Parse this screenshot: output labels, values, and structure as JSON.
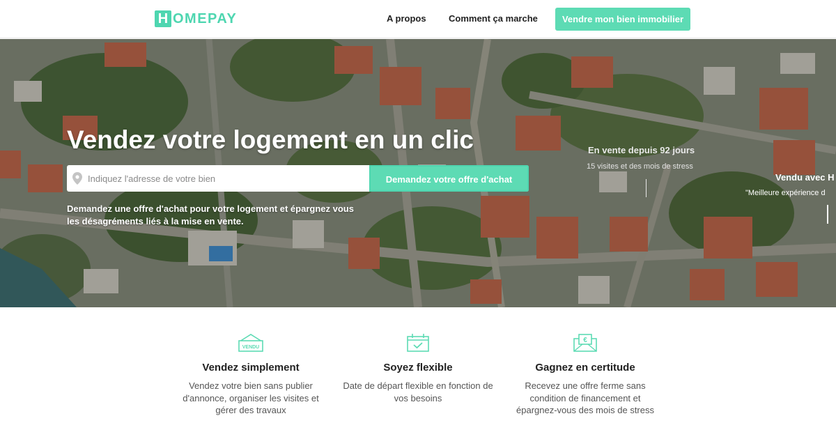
{
  "brand": {
    "logo_letter": "H",
    "logo_rest": "OMEPAY",
    "accent_color": "#5ddbb4"
  },
  "nav": {
    "items": [
      "A propos",
      "Comment ça marche"
    ],
    "cta_label": "Vendre mon bien immobilier"
  },
  "hero": {
    "title": "Vendez votre logement en un clic",
    "search": {
      "placeholder": "Indiquez l'adresse de votre bien",
      "value": "",
      "button_label": "Demandez votre offre d'achat"
    },
    "subtitle": "Demandez une offre d'achat pour votre logement et épargnez vous les désagréments liés à la mise en vente.",
    "story_1": {
      "title": "En vente depuis 92 jours",
      "subtitle": "15 visites et des mois de stress"
    },
    "story_2": {
      "title": "Vendu avec H",
      "subtitle": "\"Meilleure expérience d"
    }
  },
  "features": [
    {
      "icon": "sold-sign-icon",
      "icon_text": "VENDU",
      "title": "Vendez simplement",
      "text": "Vendez votre bien sans publier d'annonce, organiser les visites et gérer des travaux"
    },
    {
      "icon": "calendar-check-icon",
      "title": "Soyez flexible",
      "text": "Date de départ flexible en fonction de vos besoins"
    },
    {
      "icon": "euro-envelope-icon",
      "icon_text": "€",
      "title": "Gagnez en certitude",
      "text": "Recevez une offre ferme sans condition de financement et épargnez-vous des mois de stress"
    }
  ]
}
